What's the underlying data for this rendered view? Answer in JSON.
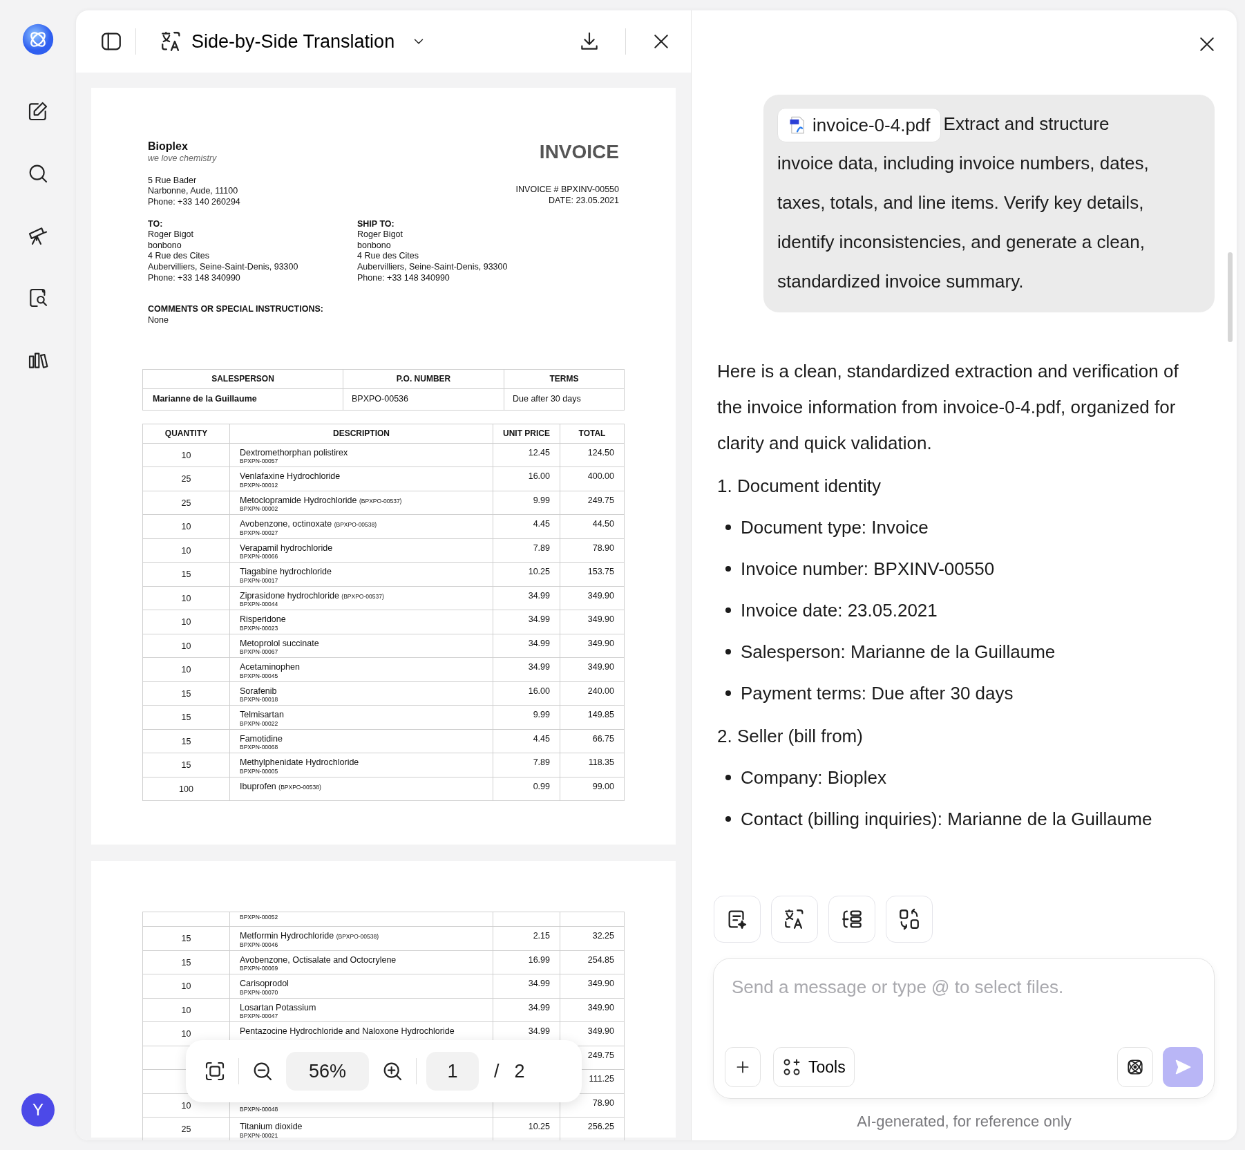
{
  "rail": {
    "avatar": "Y"
  },
  "viewer": {
    "title": "Side-by-Side Translation",
    "zoom": "56%",
    "page": "1",
    "page_separator": "/",
    "total_pages": "2"
  },
  "invoice": {
    "company": "Bioplex",
    "tagline": "we love chemistry",
    "address": [
      "5 Rue Bader",
      "Narbonne, Aude, 11100",
      "Phone: +33 140 260294"
    ],
    "title": "INVOICE",
    "number": "INVOICE # BPXINV-00550",
    "date": "DATE: 23.05.2021",
    "to": {
      "label": "TO:",
      "lines": [
        "Roger Bigot",
        "bonbono",
        "4 Rue des Cites",
        "Aubervilliers, Seine-Saint-Denis, 93300",
        "Phone: +33 148 340990"
      ]
    },
    "ship_to": {
      "label": "SHIP TO:",
      "lines": [
        "Roger Bigot",
        "bonbono",
        "4 Rue des Cites",
        "Aubervilliers, Seine-Saint-Denis, 93300",
        "Phone: +33 148 340990"
      ]
    },
    "comments_label": "COMMENTS OR SPECIAL INSTRUCTIONS:",
    "comments": "None",
    "summary_columns": [
      "SALESPERSON",
      "P.O. NUMBER",
      "TERMS"
    ],
    "summary_values": [
      "Marianne de la Guillaume",
      "BPXPO-00536",
      "Due after 30 days"
    ],
    "item_columns": [
      "QUANTITY",
      "DESCRIPTION",
      "UNIT PRICE",
      "TOTAL"
    ],
    "items": [
      {
        "qty": "10",
        "name": "Dextromethorphan polistirex",
        "code": "BPXPN-00057",
        "unit_price": "12.45",
        "total": "124.50"
      },
      {
        "qty": "25",
        "name": "Venlafaxine Hydrochloride",
        "code": "BPXPN-00012",
        "unit_price": "16.00",
        "total": "400.00"
      },
      {
        "qty": "25",
        "name": "Metoclopramide Hydrochloride",
        "ref": "(BPXPO-00537)",
        "code": "BPXPN-00002",
        "unit_price": "9.99",
        "total": "249.75"
      },
      {
        "qty": "10",
        "name": "Avobenzone, octinoxate",
        "ref": "(BPXPO-00538)",
        "code": "BPXPN-00027",
        "unit_price": "4.45",
        "total": "44.50"
      },
      {
        "qty": "10",
        "name": "Verapamil hydrochloride",
        "code": "BPXPN-00066",
        "unit_price": "7.89",
        "total": "78.90"
      },
      {
        "qty": "15",
        "name": "Tiagabine hydrochloride",
        "code": "BPXPN-00017",
        "unit_price": "10.25",
        "total": "153.75"
      },
      {
        "qty": "10",
        "name": "Ziprasidone hydrochloride",
        "ref": "(BPXPO-00537)",
        "code": "BPXPN-00044",
        "unit_price": "34.99",
        "total": "349.90"
      },
      {
        "qty": "10",
        "name": "Risperidone",
        "code": "BPXPN-00023",
        "unit_price": "34.99",
        "total": "349.90"
      },
      {
        "qty": "10",
        "name": "Metoprolol succinate",
        "code": "BPXPN-00067",
        "unit_price": "34.99",
        "total": "349.90"
      },
      {
        "qty": "10",
        "name": "Acetaminophen",
        "code": "BPXPN-00045",
        "unit_price": "34.99",
        "total": "349.90"
      },
      {
        "qty": "15",
        "name": "Sorafenib",
        "code": "BPXPN-00018",
        "unit_price": "16.00",
        "total": "240.00"
      },
      {
        "qty": "15",
        "name": "Telmisartan",
        "code": "BPXPN-00022",
        "unit_price": "9.99",
        "total": "149.85"
      },
      {
        "qty": "15",
        "name": "Famotidine",
        "code": "BPXPN-00068",
        "unit_price": "4.45",
        "total": "66.75"
      },
      {
        "qty": "15",
        "name": "Methylphenidate Hydrochloride",
        "code": "BPXPN-00005",
        "unit_price": "7.89",
        "total": "118.35"
      },
      {
        "qty": "100",
        "name": "Ibuprofen",
        "ref": "(BPXPO-00538)",
        "unit_price": "0.99",
        "total": "99.00"
      }
    ]
  },
  "invoice_page2": {
    "items": [
      {
        "kind": "continued",
        "code": "BPXPN-00052"
      },
      {
        "kind": "item",
        "qty": "15",
        "name": "Metformin Hydrochloride",
        "ref": "(BPXPO-00538)",
        "code": "BPXPN-00046",
        "unit_price": "2.15",
        "total": "32.25"
      },
      {
        "kind": "item",
        "qty": "15",
        "name": "Avobenzone, Octisalate and Octocrylene",
        "code": "BPXPN-00069",
        "unit_price": "16.99",
        "total": "254.85"
      },
      {
        "kind": "item",
        "qty": "10",
        "name": "Carisoprodol",
        "code": "BPXPN-00070",
        "unit_price": "34.99",
        "total": "349.90"
      },
      {
        "kind": "item",
        "qty": "10",
        "name": "Losartan Potassium",
        "code": "BPXPN-00047",
        "unit_price": "34.99",
        "total": "349.90"
      },
      {
        "kind": "item",
        "qty": "10",
        "name": "Pentazocine Hydrochloride and Naloxone Hydrochloride",
        "unit_price": "34.99",
        "total": "349.90"
      },
      {
        "kind": "item",
        "total": "249.75"
      },
      {
        "kind": "item",
        "total": "111.25"
      },
      {
        "kind": "item",
        "qty": "10",
        "code": "BPXPN-00048",
        "total": "78.90"
      },
      {
        "kind": "item",
        "qty": "25",
        "name": "Titanium dioxide",
        "code": "BPXPN-00021",
        "unit_price": "10.25",
        "total": "256.25"
      }
    ]
  },
  "chat": {
    "attachment": "invoice-0-4.pdf",
    "prompt_first_line": "Extract and structure",
    "prompt": "invoice data, including invoice numbers, dates, taxes, totals, and line items. Verify key details, identify inconsistencies, and generate a clean, standardized invoice summary.",
    "reply_intro": "Here is a clean, standardized extraction and verification of the invoice information from invoice-0-4.pdf, organized for clarity and quick validation.",
    "sections": [
      {
        "heading": "1. Document identity",
        "bullets": [
          "Document type: Invoice",
          "Invoice number: BPXINV-00550",
          "Invoice date: 23.05.2021",
          "Salesperson: Marianne de la Guillaume",
          "Payment terms: Due after 30 days"
        ]
      },
      {
        "heading": "2. Seller (bill from)",
        "bullets": [
          "Company: Bioplex",
          "Contact (billing inquiries): Marianne de la Guillaume"
        ]
      }
    ],
    "input": {
      "placeholder": "Send a message or type @ to select files."
    },
    "tools_label": "Tools",
    "disclaimer": "AI-generated, for reference only"
  }
}
